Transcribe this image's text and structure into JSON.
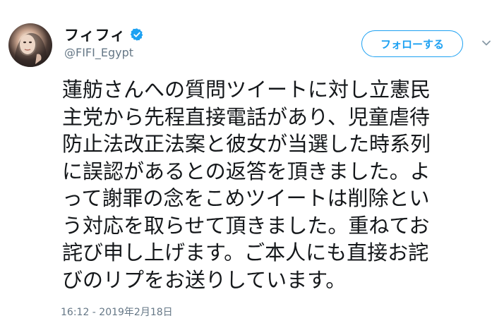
{
  "tweet": {
    "author": {
      "display_name": "フィフィ",
      "handle": "@FIFI_Egypt",
      "verified": true,
      "avatar_icon": "profile-photo"
    },
    "follow_label": "フォローする",
    "more_icon": "chevron-down-icon",
    "text_lines": [
      "蓮舫さんへの質問ツイートに対し立憲民",
      "主党から先程直接電話があり、児童虐待",
      "防止法改正法案と彼女が当選した時系列",
      "に誤認があるとの返答を頂きました。よ",
      "って謝罪の念をこめツイートは削除とい",
      "う対応を取らせて頂きました。重ねてお",
      "詫び申し上げます。ご本人にも直接お詫",
      "びのリプをお送りしています。"
    ],
    "timestamp": "16:12 - 2019年2月18日"
  },
  "colors": {
    "accent": "#1da1f2",
    "text": "#14171a",
    "muted": "#657786"
  }
}
